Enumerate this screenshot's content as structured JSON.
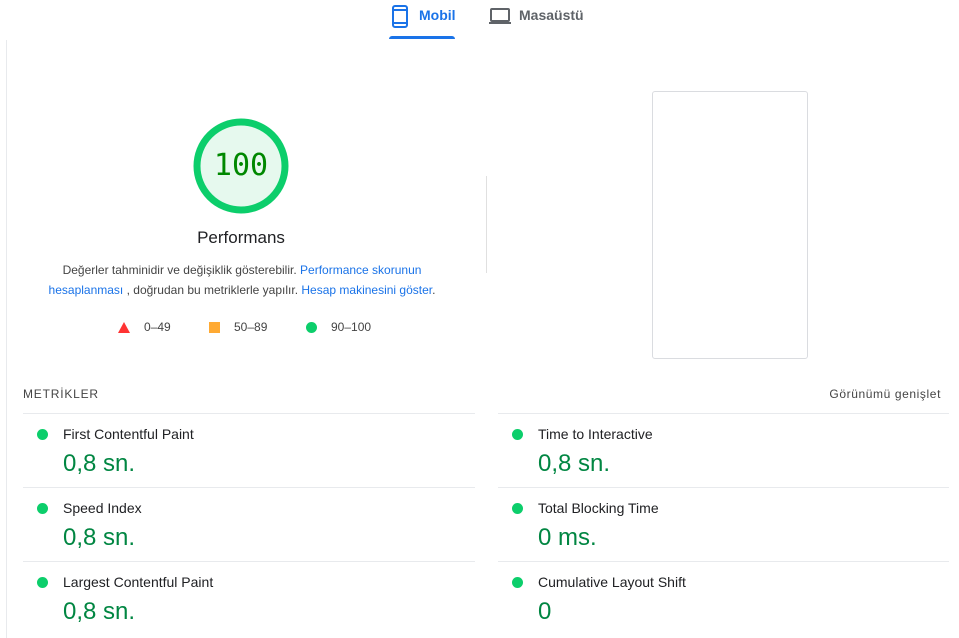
{
  "tabs": [
    {
      "label": "Mobil",
      "icon": "smartphone-icon",
      "active": true
    },
    {
      "label": "Masaüstü",
      "icon": "laptop-icon",
      "active": false
    }
  ],
  "gauge": {
    "score": "100",
    "title": "Performans",
    "color": "#0cce6b"
  },
  "description": {
    "text1": "Değerler tahminidir ve değişiklik gösterebilir.",
    "link1a": "Performance skorunun",
    "link1b": "hesaplanması",
    "text2": ", doğrudan bu metriklerle yapılır.",
    "link2": "Hesap makinesini göster",
    "text3": "."
  },
  "legend": [
    {
      "shape": "triangle",
      "range": "0–49",
      "color": "#ff3333"
    },
    {
      "shape": "square",
      "range": "50–89",
      "color": "#ffaa33"
    },
    {
      "shape": "circle",
      "range": "90–100",
      "color": "#0cce6b"
    }
  ],
  "metrics": {
    "header": "METRİKLER",
    "expand": "Görünümü genişlet",
    "left": [
      {
        "label": "First Contentful Paint",
        "value": "0,8 sn."
      },
      {
        "label": "Speed Index",
        "value": "0,8 sn."
      },
      {
        "label": "Largest Contentful Paint",
        "value": "0,8 sn."
      }
    ],
    "right": [
      {
        "label": "Time to Interactive",
        "value": "0,8 sn."
      },
      {
        "label": "Total Blocking Time",
        "value": "0 ms."
      },
      {
        "label": "Cumulative Layout Shift",
        "value": "0"
      }
    ]
  }
}
